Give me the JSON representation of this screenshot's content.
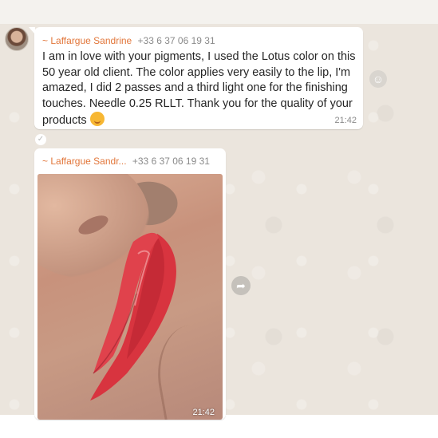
{
  "messages": [
    {
      "sender_name": "~ Laffargue Sandrine",
      "sender_phone": "+33 6 37 06 19 31",
      "text": "I am in love with your pigments, I used the Lotus color on this 50 year old client. The color applies very easily to the lip, I'm amazed, I did 2 passes and a third light one for the finishing touches. Needle 0.25 RLLT. Thank you for the quality of your products",
      "emoji": "kissing-face-emoji",
      "time": "21:42"
    },
    {
      "sender_name": "~ Laffargue Sandr...",
      "sender_phone": "+33 6 37 06 19 31",
      "image": "lips-photo",
      "time": "21:42"
    }
  ],
  "icons": {
    "reaction": "smiley-icon",
    "forward": "forward-icon",
    "status": "check-icon"
  },
  "colors": {
    "sender_name": "#e2763a",
    "bubble": "#ffffff",
    "chat_background": "#ebe5dd",
    "lip_red": "#d8343f"
  }
}
